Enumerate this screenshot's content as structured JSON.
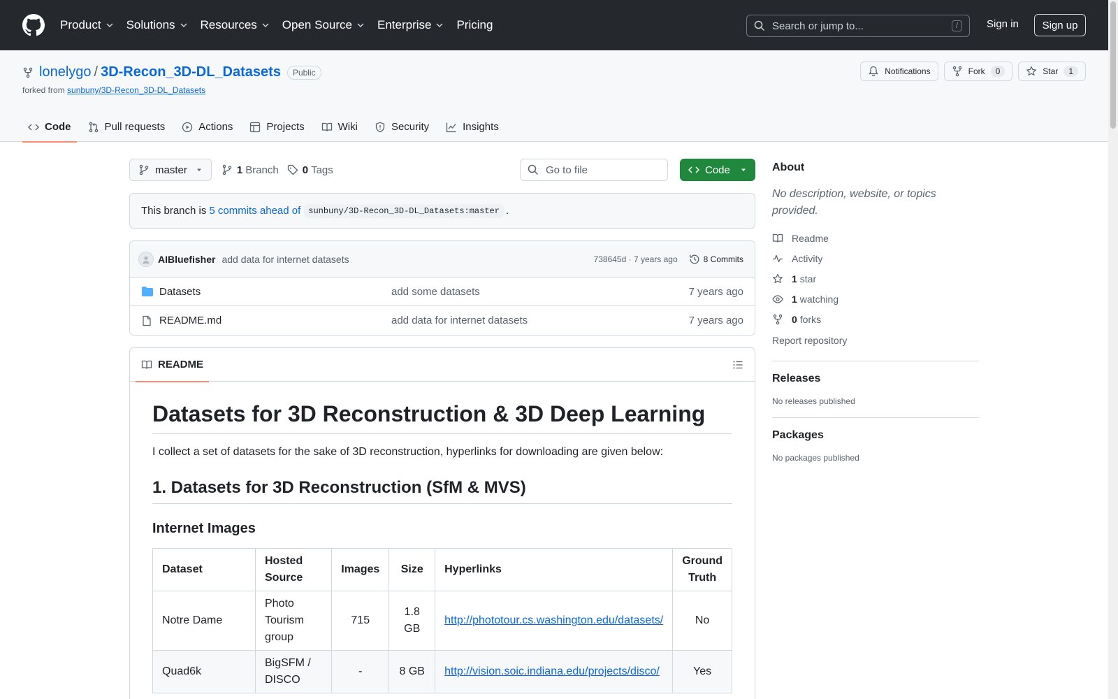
{
  "header": {
    "nav": [
      "Product",
      "Solutions",
      "Resources",
      "Open Source",
      "Enterprise",
      "Pricing"
    ],
    "search_placeholder": "Search or jump to...",
    "search_shortcut": "/",
    "signin": "Sign in",
    "signup": "Sign up"
  },
  "repo": {
    "owner": "lonelygo",
    "separator": "/",
    "name": "3D-Recon_3D-DL_Datasets",
    "visibility": "Public",
    "forked_prefix": "forked from",
    "forked_from": "sunbuny/3D-Recon_3D-DL_Datasets",
    "notifications": "Notifications",
    "fork_label": "Fork",
    "fork_count": "0",
    "star_label": "Star",
    "star_count": "1"
  },
  "tabs": [
    "Code",
    "Pull requests",
    "Actions",
    "Projects",
    "Wiki",
    "Security",
    "Insights"
  ],
  "toolbar": {
    "branch": "master",
    "branch_count": "1",
    "branch_label": "Branch",
    "tag_count": "0",
    "tag_label": "Tags",
    "goto_placeholder": "Go to file",
    "code_label": "Code"
  },
  "ahead": {
    "prefix": "This branch is",
    "link": "5 commits ahead of",
    "ref": "sunbuny/3D-Recon_3D-DL_Datasets:master",
    "suffix": "."
  },
  "commit": {
    "author": "AIBluefisher",
    "message": "add data for internet datasets",
    "sha_time": "738645d · 7 years ago",
    "commits": "8 Commits"
  },
  "files": [
    {
      "name": "Datasets",
      "message": "add some datasets",
      "date": "7 years ago",
      "icon": "folder-icon"
    },
    {
      "name": "README.md",
      "message": "add data for internet datasets",
      "date": "7 years ago",
      "icon": "file-icon"
    }
  ],
  "readme": {
    "tab": "README",
    "h1": "Datasets for 3D Reconstruction & 3D Deep Learning",
    "intro": "I collect a set of datasets for the sake of 3D reconstruction, hyperlinks for downloading are given below:",
    "h2": "1. Datasets for 3D Reconstruction (SfM & MVS)",
    "h3": "Internet Images",
    "table": {
      "headers": [
        "Dataset",
        "Hosted Source",
        "Images",
        "Size",
        "Hyperlinks",
        "Ground Truth"
      ],
      "rows": [
        [
          "Notre Dame",
          "Photo Tourism group",
          "715",
          "1.8 GB",
          "http://phototour.cs.washington.edu/datasets/",
          "No"
        ],
        [
          "Quad6k",
          "BigSFM / DISCO",
          "-",
          "8 GB",
          "http://vision.soic.indiana.edu/projects/disco/",
          "Yes"
        ]
      ]
    }
  },
  "about": {
    "title": "About",
    "description": "No description, website, or topics provided.",
    "readme": "Readme",
    "activity": "Activity",
    "stars_count": "1",
    "stars_label": "star",
    "watching_count": "1",
    "watching_label": "watching",
    "forks_count": "0",
    "forks_label": "forks",
    "report": "Report repository"
  },
  "releases": {
    "title": "Releases",
    "text": "No releases published"
  },
  "packages": {
    "title": "Packages",
    "text": "No packages published"
  },
  "colors": {
    "header_bg": "#25292e",
    "link": "#0969da",
    "primary_button": "#1f883d",
    "tab_underline": "#fd8c73"
  }
}
